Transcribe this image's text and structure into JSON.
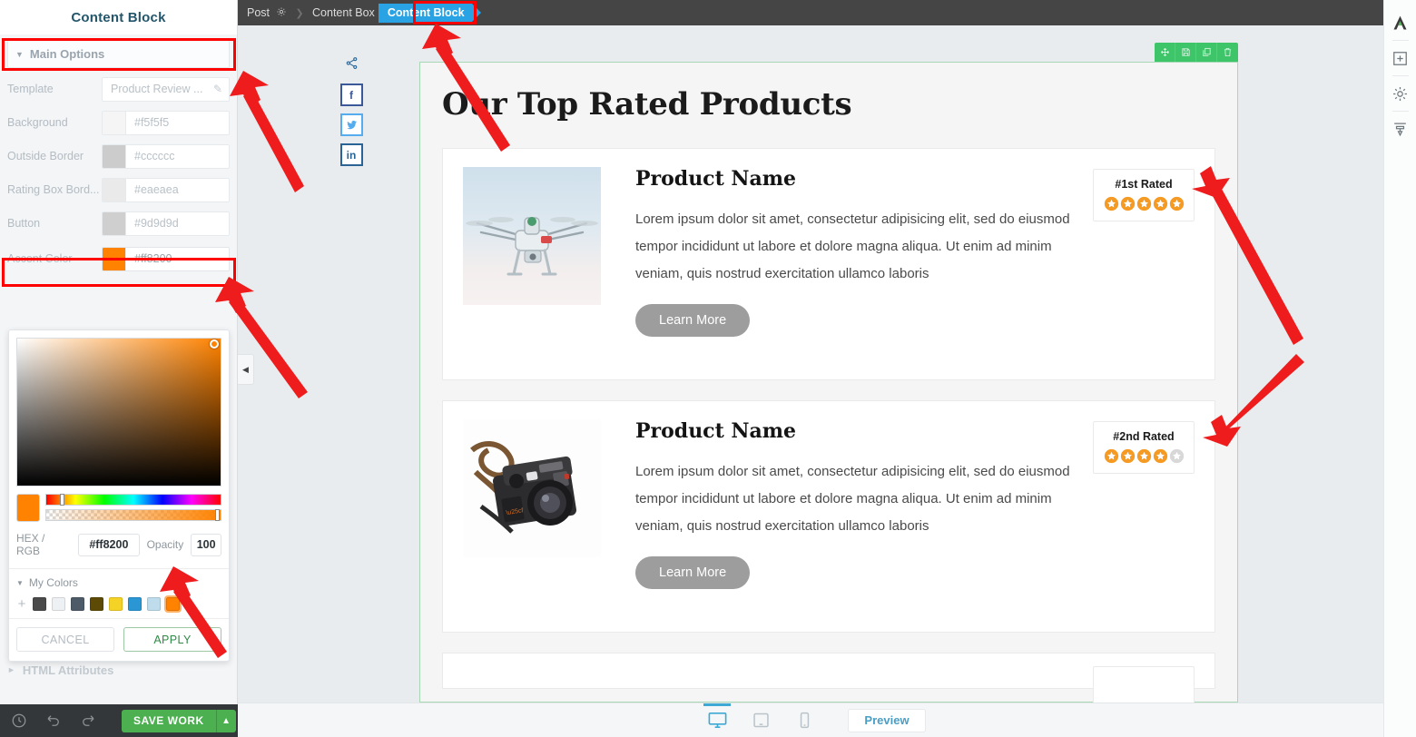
{
  "sidebar": {
    "title": "Content Block",
    "section_main": {
      "label": "Main Options",
      "caret": "caret-down-icon"
    },
    "fields": [
      {
        "label": "Template",
        "value": "Product Review ...",
        "swatch": null,
        "has_pencil": true
      },
      {
        "label": "Background",
        "value": "#f5f5f5",
        "swatch": "#f5f5f5",
        "has_pencil": false
      },
      {
        "label": "Outside Border",
        "value": "#cccccc",
        "swatch": "#cccccc",
        "has_pencil": false
      },
      {
        "label": "Rating Box Bord...",
        "value": "#eaeaea",
        "swatch": "#eaeaea",
        "has_pencil": false
      },
      {
        "label": "Button",
        "value": "#9d9d9d",
        "swatch": "#9d9d9d",
        "has_pencil": false
      },
      {
        "label": "Accent Color",
        "value": "#ff8200",
        "swatch": "#ff8200",
        "has_pencil": false
      }
    ],
    "section_html": {
      "label": "HTML Attributes",
      "caret": "caret-right-icon"
    }
  },
  "color_picker": {
    "selected_color": "#ff8200",
    "hex_label": "HEX / RGB",
    "hex_value": "#ff8200",
    "opacity_label": "Opacity",
    "opacity_value": "100",
    "my_colors_label": "My Colors",
    "add_swatch": "+",
    "swatches": [
      "#4a4a4a",
      "#eef1f4",
      "#4d5a68",
      "#5c4a06",
      "#f5d226",
      "#2a97d4",
      "#bfdcec",
      "#ff8200"
    ],
    "selected_swatch_index": 7,
    "cancel_label": "CANCEL",
    "apply_label": "APPLY"
  },
  "bottom_left_bar": {
    "icons": [
      "history-icon",
      "undo-icon",
      "redo-icon"
    ],
    "save_label": "SAVE WORK",
    "save_caret": "chevron-up-icon"
  },
  "topbar": {
    "crumbs": [
      {
        "label": "Post",
        "active": false,
        "gear": true
      },
      {
        "label": "Content Box",
        "active": false,
        "gear": false
      },
      {
        "label": "Content Block",
        "active": true,
        "gear": false
      }
    ]
  },
  "canvas": {
    "collapse_tab": "collapse-left-icon",
    "social": {
      "share_icon": "share-icon",
      "items": [
        {
          "name": "facebook-icon",
          "glyph": "f",
          "color": "#3b5998"
        },
        {
          "name": "twitter-icon",
          "glyph": "ᵥ",
          "color": "#55acee"
        },
        {
          "name": "linkedin-icon",
          "glyph": "in",
          "color": "#2a6496"
        }
      ]
    },
    "block_tools": [
      "move-icon",
      "save-icon",
      "duplicate-icon",
      "trash-icon"
    ],
    "heading": "Our Top Rated Products",
    "products": [
      {
        "image": "drone-photo",
        "name": "Product Name",
        "description": "Lorem ipsum dolor sit amet, consectetur adipisicing elit, sed do eiusmod tempor incididunt ut labore et dolore magna aliqua. Ut enim ad minim veniam, quis nostrud exercitation ullamco laboris",
        "button": "Learn More",
        "rating_label": "#1st Rated",
        "stars_filled": 5,
        "stars_total": 5
      },
      {
        "image": "camera-photo",
        "name": "Product Name",
        "description": "Lorem ipsum dolor sit amet, consectetur adipisicing elit, sed do eiusmod tempor incididunt ut labore et dolore magna aliqua. Ut enim ad minim veniam, quis nostrud exercitation ullamco laboris",
        "button": "Learn More",
        "rating_label": "#2nd Rated",
        "stars_filled": 4,
        "stars_total": 5
      }
    ]
  },
  "device_bar": {
    "devices": [
      {
        "name": "desktop-icon",
        "active": true
      },
      {
        "name": "tablet-icon",
        "active": false
      },
      {
        "name": "mobile-icon",
        "active": false
      }
    ],
    "preview_label": "Preview"
  },
  "right_rail": {
    "items": [
      "logo-icon",
      "add-icon",
      "settings-icon",
      "templates-icon"
    ]
  },
  "colors": {
    "accent": "#ff8200",
    "highlight_outline": "#ff0000",
    "arrow": "#ee1c1c",
    "crumb_active": "#29a3e3",
    "save_green": "#4caf50",
    "block_border": "#a9d8b5",
    "star_filled": "#f59a23",
    "star_empty": "#d8d8d8"
  },
  "annotations": {
    "highlight_boxes": [
      "main-options-row",
      "accent-color-row",
      "content-block-crumb"
    ],
    "arrow_count": 4
  }
}
